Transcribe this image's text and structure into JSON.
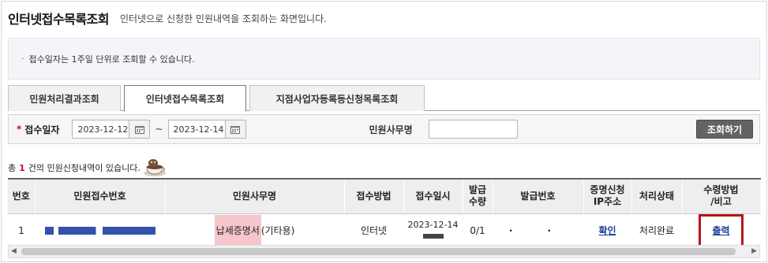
{
  "header": {
    "title": "인터넷접수목록조회",
    "subtitle": "인터넷으로 신청한 민원내역을 조회하는 화면입니다."
  },
  "notice": {
    "bullet": "·",
    "text": "접수일자는 1주일 단위로 조회할 수 있습니다."
  },
  "tabs": [
    {
      "label": "민원처리결과조회",
      "active": false
    },
    {
      "label": "인터넷접수목록조회",
      "active": true
    },
    {
      "label": "지점사업자등록등신청목록조회",
      "active": false
    }
  ],
  "search": {
    "required_mark": "*",
    "date_label": "접수일자",
    "date_from": "2023-12-12",
    "date_to": "2023-12-14",
    "tilde": "~",
    "office_label": "민원사무명",
    "office_value": "",
    "submit_label": "조회하기"
  },
  "result": {
    "prefix": "총",
    "count": "1",
    "suffix": "건의 민원신청내역이 있습니다."
  },
  "table": {
    "headers": {
      "no": "번호",
      "receipt_no": "민원접수번호",
      "office": "민원사무명",
      "method": "접수방법",
      "received_at": "접수일시",
      "issue_qty_line1": "발급",
      "issue_qty_line2": "수량",
      "issue_no": "발급번호",
      "ip_line1": "증명신청",
      "ip_line2": "IP주소",
      "status": "처리상태",
      "receive_line1": "수령방법",
      "receive_line2": "/비고"
    },
    "rows": [
      {
        "no": "1",
        "office_highlight": "납세증명서",
        "office_rest": "(기타용)",
        "method": "인터넷",
        "received_date": "2023-12-14",
        "issue_qty": "0/1",
        "issue_no": "· ·",
        "ip": "확인",
        "status": "처리완료",
        "receive": "출력"
      }
    ]
  }
}
